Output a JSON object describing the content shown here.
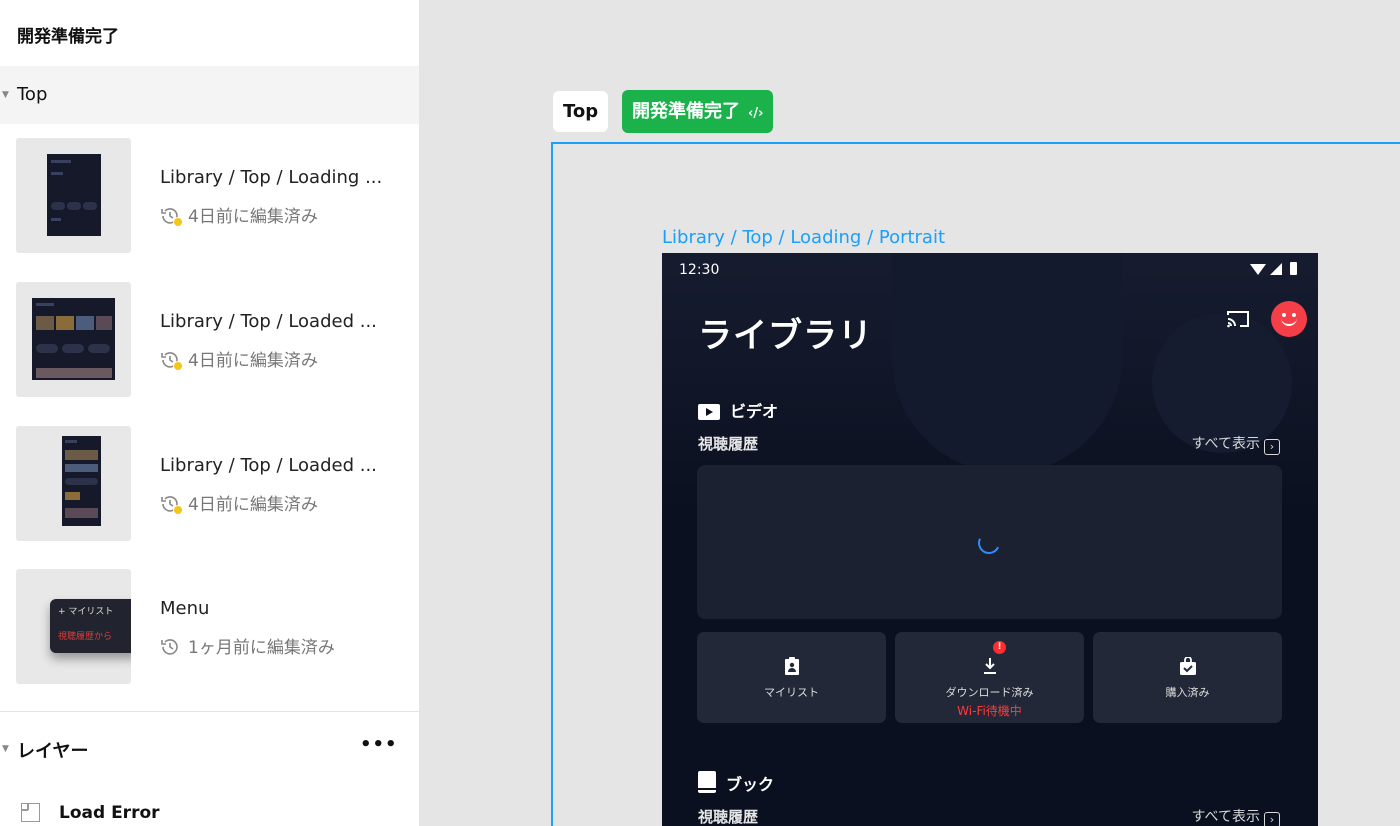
{
  "left_panel": {
    "title": "開発準備完了",
    "section": {
      "label": "Top"
    },
    "frames": [
      {
        "name": "Library / Top / Loading ...",
        "meta": "4日前に編集済み"
      },
      {
        "name": "Library / Top / Loaded ...",
        "meta": "4日前に編集済み"
      },
      {
        "name": "Library / Top / Loaded ...",
        "meta": "4日前に編集済み"
      },
      {
        "name": "Menu",
        "meta": "1ヶ月前に編集済み",
        "menu_preview": {
          "item1": "+ マイリスト",
          "item2": "視聴履歴から"
        }
      }
    ],
    "layers": {
      "label": "レイヤー",
      "more": "•••",
      "items": [
        {
          "label": "Load Error"
        }
      ]
    }
  },
  "canvas": {
    "tag_page": "Top",
    "tag_status": "開発準備完了",
    "tag_status_code": "‹/›",
    "frame_title": "Library / Top / Loading / Portrait",
    "selection_color": "#18a0fb",
    "status_green": "#1bb24b"
  },
  "phone": {
    "time": "12:30",
    "title": "ライブラリ",
    "video_section": {
      "label": "ビデオ",
      "row_label": "視聴履歴",
      "see_all": "すべて表示"
    },
    "tiles": [
      {
        "label": "マイリスト",
        "icon": "clipboard-person-icon"
      },
      {
        "label": "ダウンロード済み",
        "sub": "Wi-Fi待機中",
        "badge": "!",
        "icon": "download-icon"
      },
      {
        "label": "購入済み",
        "icon": "shopping-bag-check-icon"
      }
    ],
    "book_section": {
      "label": "ブック",
      "row_label": "視聴履歴",
      "see_all": "すべて表示"
    },
    "avatar_color": "#f43f48",
    "spinner_color": "#2d8cff",
    "warning_color": "#ff3b3b"
  }
}
